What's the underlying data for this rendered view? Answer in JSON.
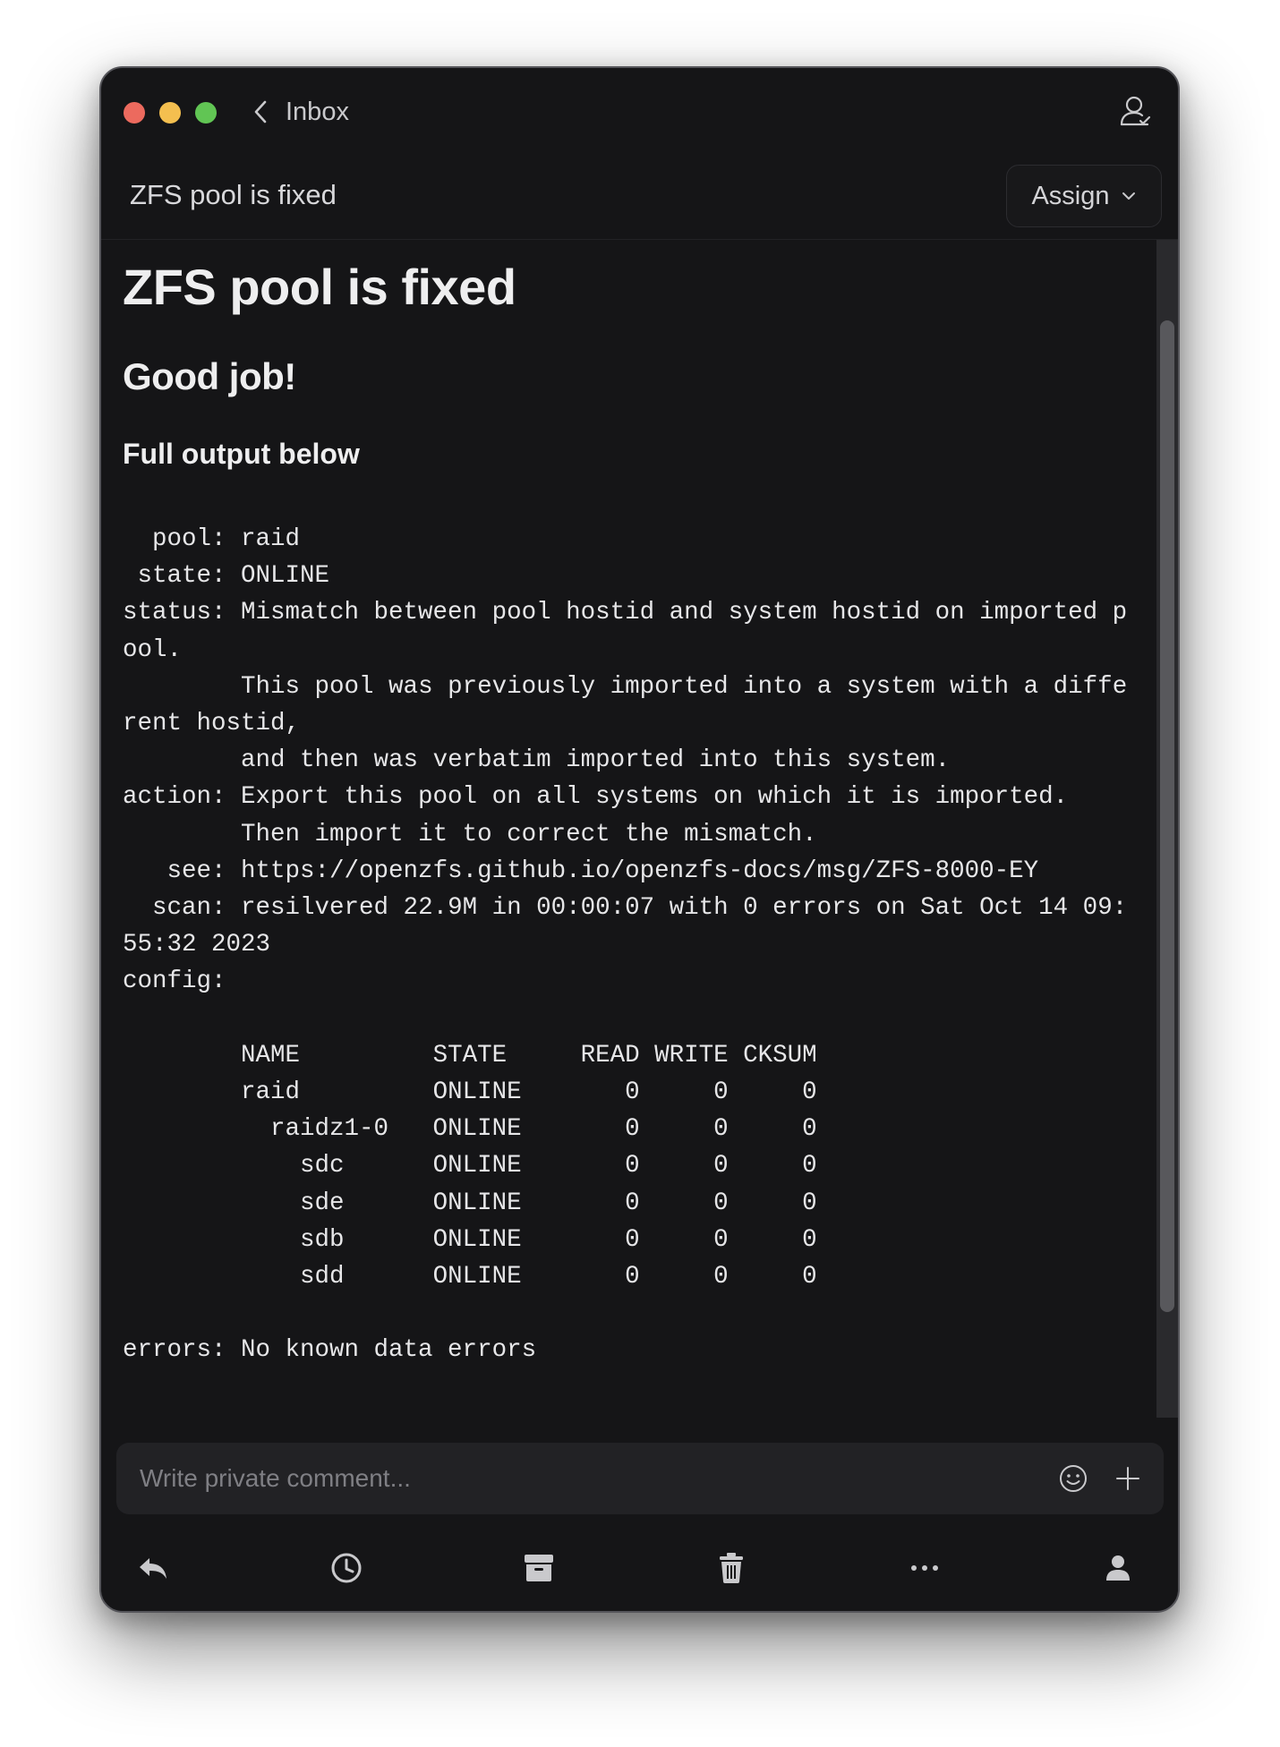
{
  "titlebar": {
    "back_label": "Inbox"
  },
  "subheader": {
    "title": "ZFS pool is fixed",
    "assign_label": "Assign"
  },
  "message": {
    "heading1": "ZFS pool is fixed",
    "heading2": "Good job!",
    "heading3": "Full output below",
    "output": "  pool: raid\n state: ONLINE\nstatus: Mismatch between pool hostid and system hostid on imported pool.\n        This pool was previously imported into a system with a different hostid,\n        and then was verbatim imported into this system.\naction: Export this pool on all systems on which it is imported.\n        Then import it to correct the mismatch.\n   see: https://openzfs.github.io/openzfs-docs/msg/ZFS-8000-EY\n  scan: resilvered 22.9M in 00:00:07 with 0 errors on Sat Oct 14 09:55:32 2023\nconfig:\n\n        NAME         STATE     READ WRITE CKSUM\n        raid         ONLINE       0     0     0\n          raidz1-0   ONLINE       0     0     0\n            sdc      ONLINE       0     0     0\n            sde      ONLINE       0     0     0\n            sdb      ONLINE       0     0     0\n            sdd      ONLINE       0     0     0\n\nerrors: No known data errors"
  },
  "composer": {
    "placeholder": "Write private comment..."
  },
  "icons": {
    "back": "chevron-left-icon",
    "user": "user-check-icon",
    "emoji": "smiley-icon",
    "plus": "plus-icon",
    "reply": "reply-icon",
    "snooze": "clock-icon",
    "archive": "archive-icon",
    "trash": "trash-icon",
    "more": "ellipsis-icon",
    "assignee": "person-icon"
  },
  "colors": {
    "window_bg": "#151517",
    "traffic_red": "#ec6a5e",
    "traffic_yellow": "#f4bf4f",
    "traffic_green": "#61c554",
    "text": "#e6e6e8",
    "muted": "#7f7f84"
  }
}
